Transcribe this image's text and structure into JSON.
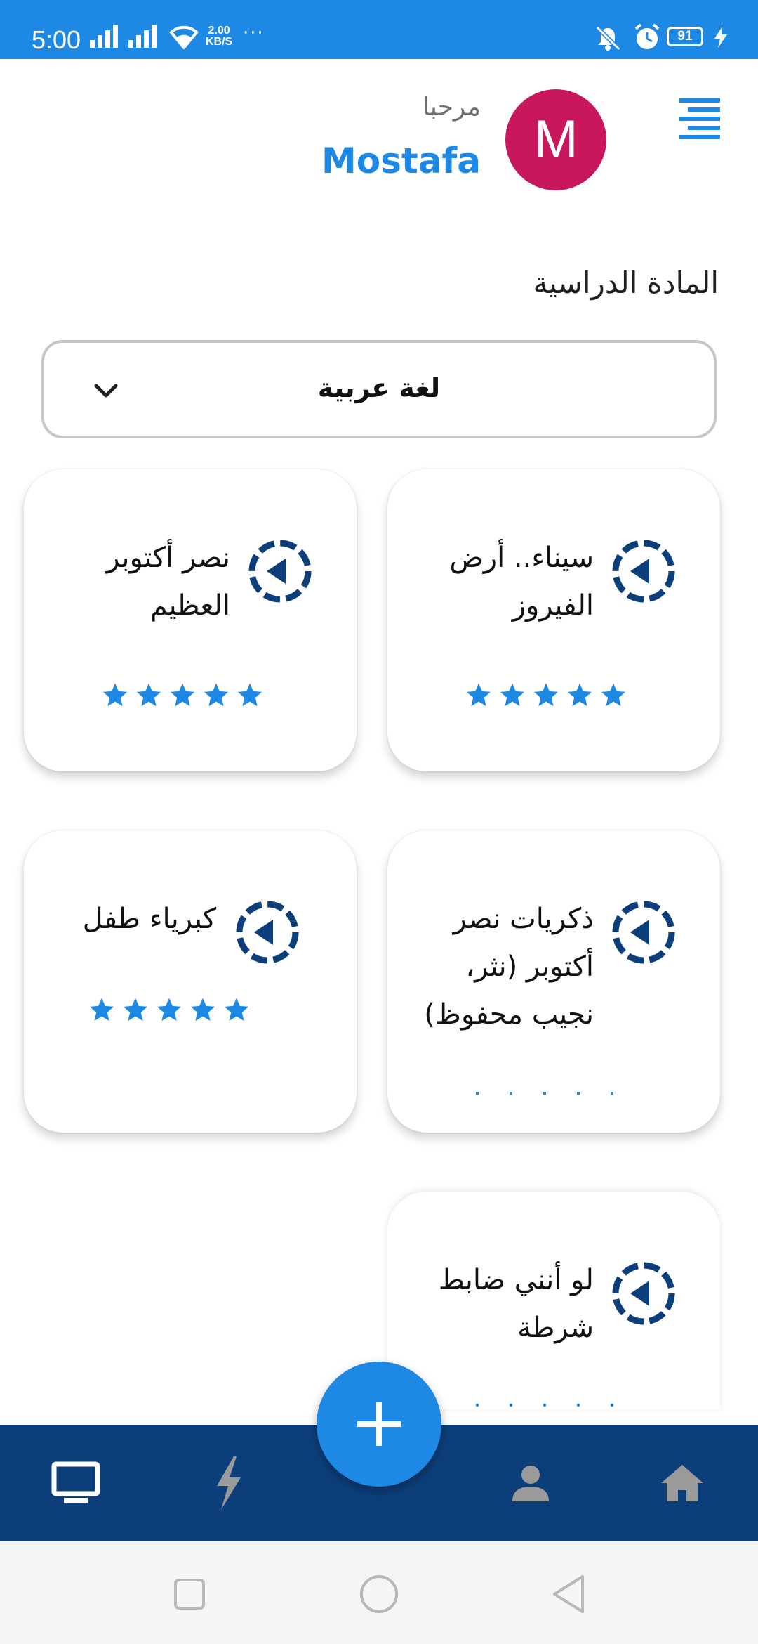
{
  "status_bar": {
    "time": "5:00",
    "speed_value": "2.00",
    "speed_unit": "KB/S",
    "more": "···",
    "battery": "91"
  },
  "header": {
    "greeting": "مرحبا",
    "user_name": "Mostafa",
    "avatar_initial": "M"
  },
  "subject": {
    "label": "المادة الدراسية",
    "selected": "لغة عربية"
  },
  "lessons": [
    {
      "title_lines": [
        "سيناء.. أرض",
        "الفيروز"
      ],
      "rating": 5
    },
    {
      "title_lines": [
        "نصر أكتوبر",
        "العظيم"
      ],
      "rating": 5
    },
    {
      "title_lines": [
        "ذكريات نصر",
        "أكتوبر (نثر،",
        "نجيب محفوظ)"
      ],
      "rating": 0
    },
    {
      "title_lines": [
        "كبرياء طفل"
      ],
      "rating": 5
    },
    {
      "title_lines": [
        "لو أنني ضابط",
        "شرطة"
      ],
      "rating": 0
    }
  ],
  "bottom_nav": {
    "items": [
      "monitor-icon",
      "bolt-icon",
      "person-icon",
      "home-icon"
    ],
    "fab": "plus-icon"
  },
  "colors": {
    "primary": "#1e88e5",
    "nav_background": "#0c3f7a",
    "avatar": "#c8175d",
    "play_icon": "#0c3f7a"
  }
}
